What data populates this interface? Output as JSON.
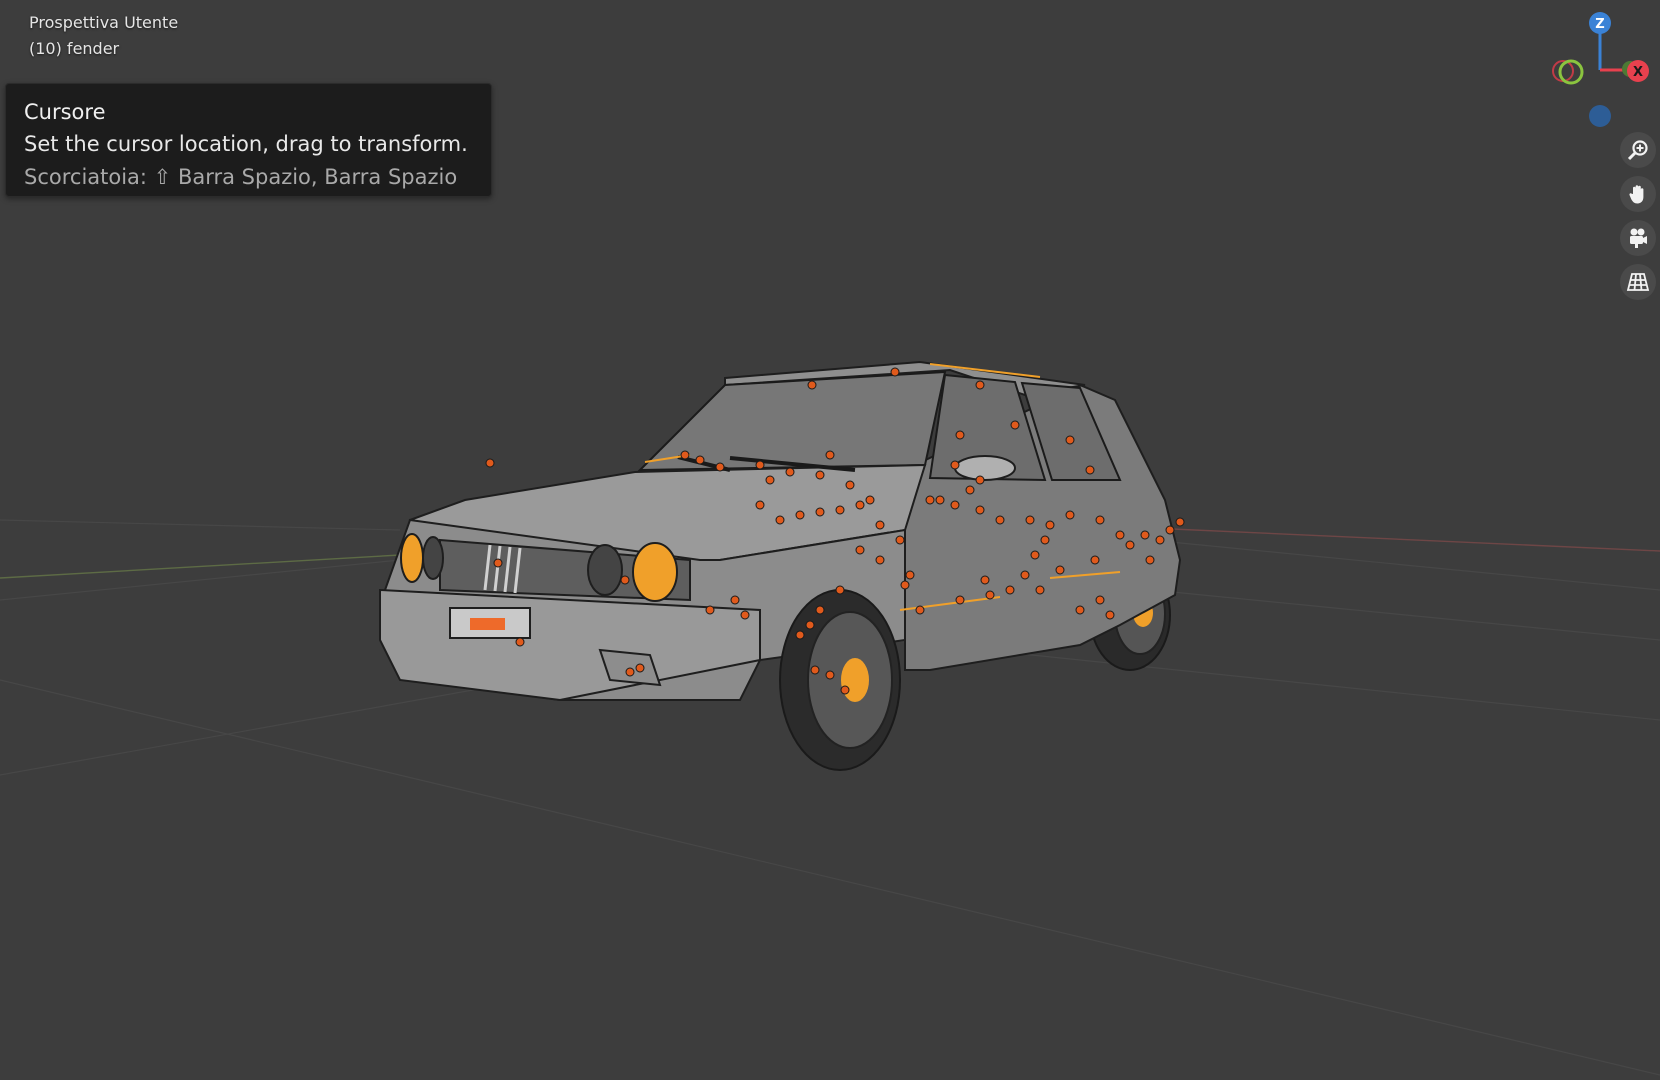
{
  "viewport": {
    "view_name": "Prospettiva Utente",
    "object_info": "(10) fender"
  },
  "tooltip": {
    "title": "Cursore",
    "description": "Set the cursor location, drag to transform.",
    "shortcut": "Scorciatoia: ⇧ Barra Spazio, Barra Spazio"
  },
  "gizmo": {
    "z_label": "Z",
    "x_label": "X",
    "colors": {
      "x": "#e8414e",
      "y": "#8bc43f",
      "z": "#3a82d6"
    }
  },
  "nav_buttons": [
    {
      "icon": "zoom-icon"
    },
    {
      "icon": "hand-pan-icon"
    },
    {
      "icon": "camera-icon"
    },
    {
      "icon": "ortho-grid-icon"
    }
  ],
  "colors": {
    "background": "#3d3d3d",
    "selection": "#f0a02a",
    "vertex": "#e05a1c"
  }
}
